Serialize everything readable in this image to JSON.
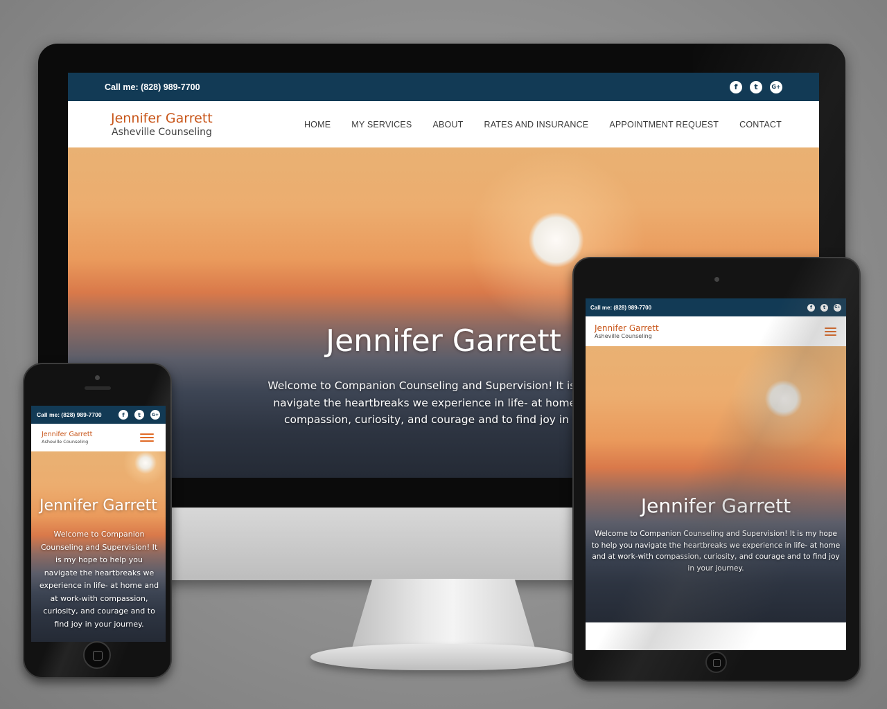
{
  "site": {
    "phone_text": "Call me: (828) 989-7700",
    "brand_name": "Jennifer Garrett",
    "brand_sub": "Asheville Counseling",
    "social": [
      {
        "icon": "facebook-icon",
        "glyph": "f"
      },
      {
        "icon": "twitter-icon",
        "glyph": "t"
      },
      {
        "icon": "google-plus-icon",
        "glyph": "G+"
      }
    ],
    "menu": [
      "HOME",
      "MY SERVICES",
      "ABOUT",
      "RATES AND INSURANCE",
      "APPOINTMENT REQUEST",
      "CONTACT"
    ],
    "hero_title": "Jennifer Garrett",
    "hero_text": "Welcome to Companion Counseling and Supervision! It is my hope to help you navigate the heartbreaks we experience in life- at home and at work-with compassion, curiosity, and courage and to find joy in your journey."
  },
  "desktop_hero_lines": [
    "Welcome to Companion Counseling and Supervision! It is my hop",
    "navigate the heartbreaks we experience in life- at home and at",
    "compassion, curiosity, and courage and to find joy in your j"
  ],
  "colors": {
    "topbar": "#123a55",
    "brand": "#c8561a",
    "burger": "#e06a26"
  }
}
